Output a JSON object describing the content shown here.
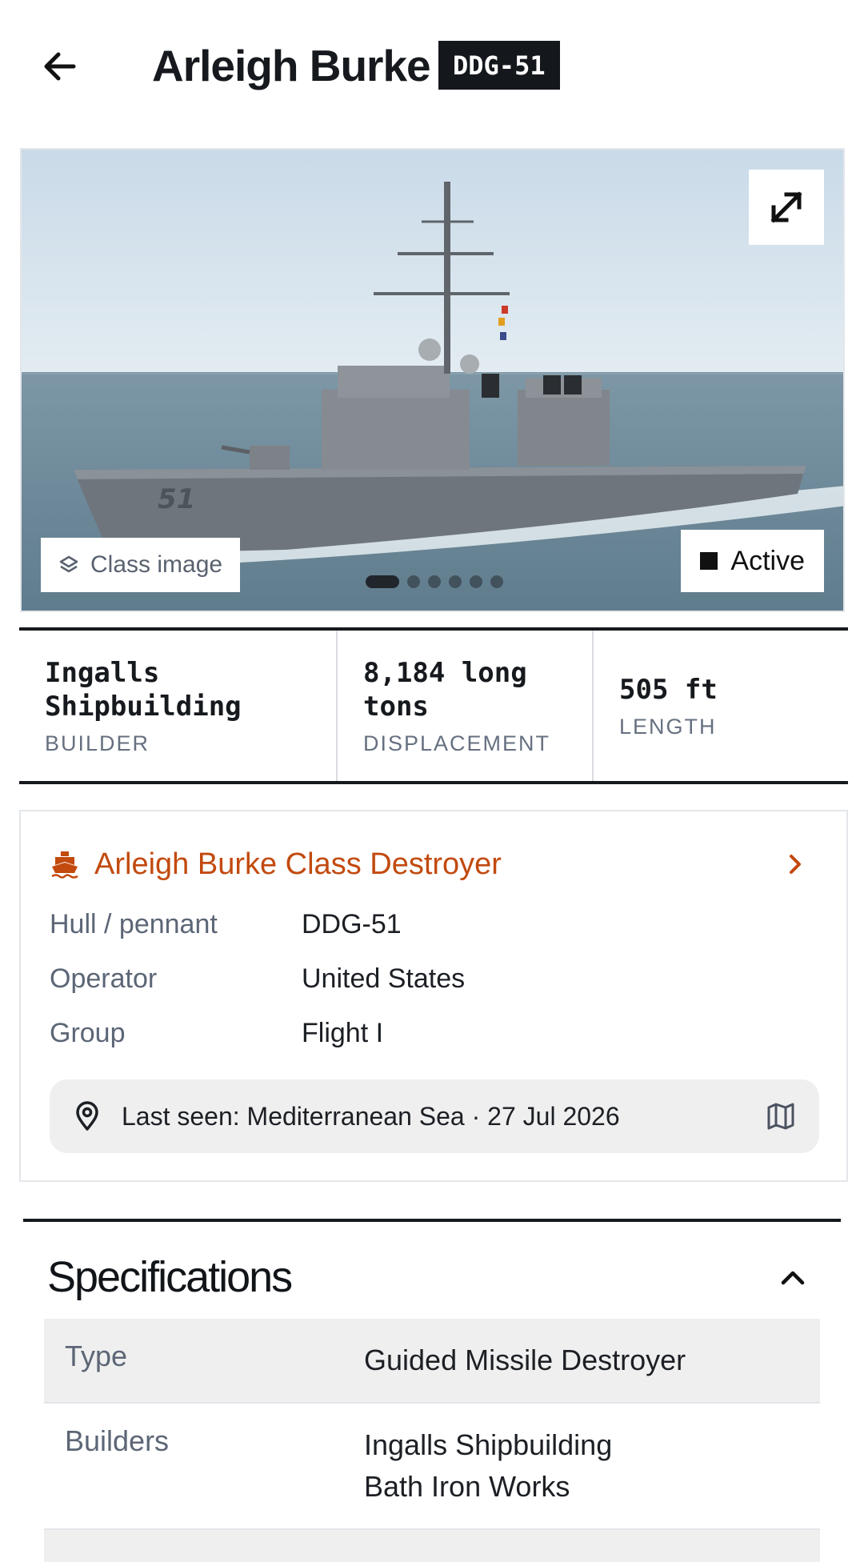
{
  "header": {
    "back_icon": "arrow-left-icon",
    "title": "Arleigh Burke",
    "hull_badge": "DDG-51"
  },
  "hero": {
    "expand_icon": "expand-diagonal-icon",
    "class_chip": {
      "icon": "layers-icon",
      "label": "Class image"
    },
    "status_chip": {
      "label": "Active"
    },
    "hull_number_on_ship": "51",
    "carousel": {
      "count": 6,
      "active_index": 0
    }
  },
  "stats": [
    {
      "value": "Ingalls\nShipbuilding",
      "label": "BUILDER"
    },
    {
      "value": "8,184 long\ntons",
      "label": "DISPLACEMENT"
    },
    {
      "value": "505 ft",
      "label": "LENGTH"
    }
  ],
  "class_card": {
    "icon": "ship-icon",
    "class_name": "Arleigh Burke Class Destroyer",
    "chevron_icon": "chevron-right-icon",
    "accent_color": "#c24a0f",
    "rows": [
      {
        "key": "Hull / pennant",
        "value": "DDG-51"
      },
      {
        "key": "Operator",
        "value": "United States"
      },
      {
        "key": "Group",
        "value": "Flight I"
      }
    ],
    "last_seen": {
      "icon": "location-pin-icon",
      "text": "Last seen: Mediterranean Sea · 27 Jul 2026",
      "map_icon": "map-icon"
    }
  },
  "specifications": {
    "title": "Specifications",
    "caret_icon": "chevron-up-icon",
    "rows": [
      {
        "key": "Type",
        "value": "Guided Missile Destroyer"
      },
      {
        "key": "Builders",
        "value": "Ingalls Shipbuilding\nBath Iron Works"
      }
    ]
  }
}
